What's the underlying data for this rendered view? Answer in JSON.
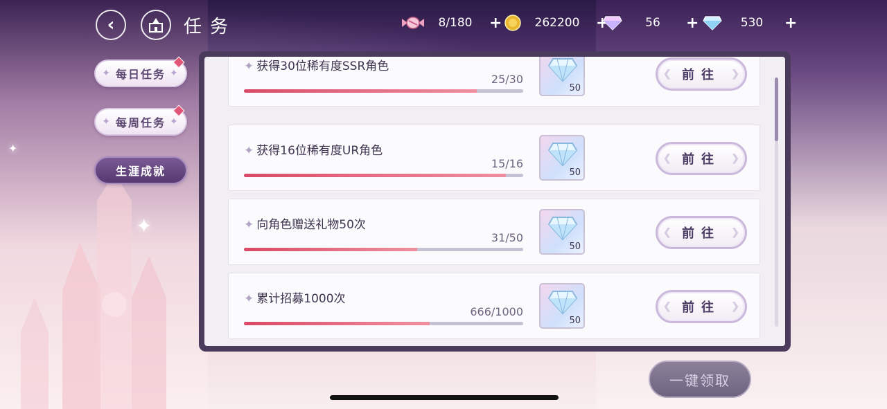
{
  "header": {
    "title": "任务",
    "resources": [
      {
        "icon": "candy-icon",
        "value": "8/180"
      },
      {
        "icon": "gold-coin-icon",
        "value": "262200"
      },
      {
        "icon": "pink-diamond-icon",
        "value": "56"
      },
      {
        "icon": "blue-diamond-icon",
        "value": "530"
      }
    ],
    "plus": "+"
  },
  "tabs": [
    {
      "label": "每日任务",
      "active": false,
      "badge": true
    },
    {
      "label": "每周任务",
      "active": false,
      "badge": true
    },
    {
      "label": "生涯成就",
      "active": true,
      "badge": false
    }
  ],
  "tasks": [
    {
      "name": "获得30位稀有度SSR角色",
      "progress": "25/30",
      "fraction": 0.833,
      "reward_count": "50",
      "button": "前往"
    },
    {
      "name": "获得16位稀有度UR角色",
      "progress": "15/16",
      "fraction": 0.9375,
      "reward_count": "50",
      "button": "前往"
    },
    {
      "name": "向角色赠送礼物50次",
      "progress": "31/50",
      "fraction": 0.62,
      "reward_count": "50",
      "button": "前往"
    },
    {
      "name": "累计招募1000次",
      "progress": "666/1000",
      "fraction": 0.666,
      "reward_count": "50",
      "button": "前往"
    }
  ],
  "footer": {
    "claim_all": "一键领取"
  },
  "colors": {
    "progress_fill": "#d94a68",
    "panel_border": "#4a3a5c",
    "active_tab": "#5b3f76"
  }
}
